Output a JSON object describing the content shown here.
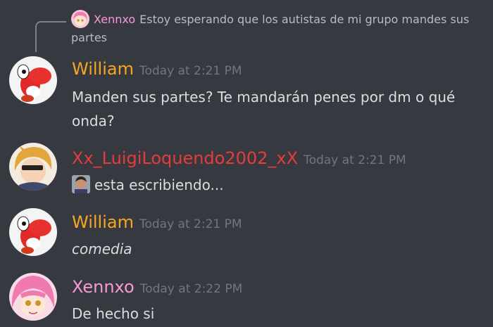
{
  "reply": {
    "author": "Xennxo",
    "text": "Estoy esperando que los autistas de mi grupo mandes sus partes"
  },
  "messages": [
    {
      "author": "William",
      "author_color": "#f5a623",
      "timestamp": "Today at 2:21 PM",
      "text": "Manden sus partes? Te mandarán penes por dm o qué onda?"
    },
    {
      "author": "Xx_LuigiLoquendo2002_xX",
      "author_color": "#e63b3b",
      "timestamp": "Today at 2:21 PM",
      "text": "esta escribiendo..."
    },
    {
      "author": "William",
      "author_color": "#f5a623",
      "timestamp": "Today at 2:21 PM",
      "text": "comedia"
    },
    {
      "author": "Xennxo",
      "author_color": "#f59ad6",
      "timestamp": "Today at 2:22 PM",
      "text": "De hecho si"
    }
  ]
}
